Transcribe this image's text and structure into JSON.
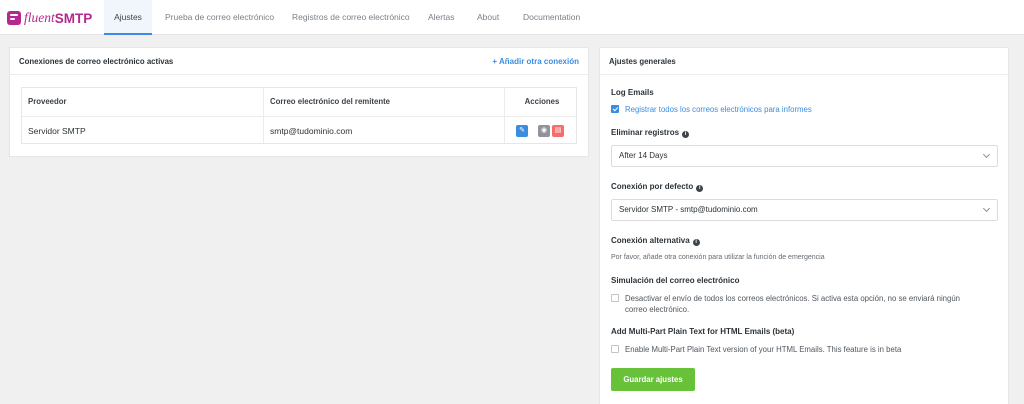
{
  "brand": {
    "part1": "fluent",
    "part2": "SMTP"
  },
  "nav": {
    "tabs": [
      {
        "label": "Ajustes"
      },
      {
        "label": "Prueba de correo electrónico"
      },
      {
        "label": "Registros de correo electrónico"
      },
      {
        "label": "Alertas"
      },
      {
        "label": "About"
      },
      {
        "label": "Documentation"
      }
    ]
  },
  "connections": {
    "title": "Conexiones de correo electrónico activas",
    "add_link": "+ Añadir otra conexión",
    "columns": [
      "Proveedor",
      "Correo electrónico del remitente",
      "Acciones"
    ],
    "rows": [
      {
        "provider": "Servidor SMTP",
        "sender": "smtp@tudominio.com"
      }
    ]
  },
  "settings": {
    "title": "Ajustes generales",
    "log_emails": {
      "label": "Log Emails",
      "checkbox_label": "Registrar todos los correos electrónicos para informes",
      "checked": true
    },
    "delete_logs": {
      "label": "Eliminar registros",
      "value": "After 14 Days"
    },
    "default_connection": {
      "label": "Conexión por defecto",
      "value": "Servidor SMTP - smtp@tudominio.com"
    },
    "fallback": {
      "label": "Conexión alternativa",
      "helper": "Por favor, añade otra conexión para utilizar la función de emergencia"
    },
    "simulation": {
      "label": "Simulación del correo electrónico",
      "checkbox_line1": "Desactivar el envío de todos los correos electrónicos. Si activa esta opción, no se enviará ningún",
      "checkbox_line2": "correo electrónico.",
      "checked": false
    },
    "multipart": {
      "label": "Add Multi-Part Plain Text for HTML Emails (beta)",
      "checkbox_label": "Enable Multi-Part Plain Text version of your HTML Emails. This feature is in beta",
      "checked": false
    },
    "save_label": "Guardar ajustes"
  },
  "colors": {
    "brand": "#b5288f",
    "accent": "#3b8de0",
    "save": "#67c23a",
    "delete": "#f56c6c",
    "view": "#909399"
  }
}
